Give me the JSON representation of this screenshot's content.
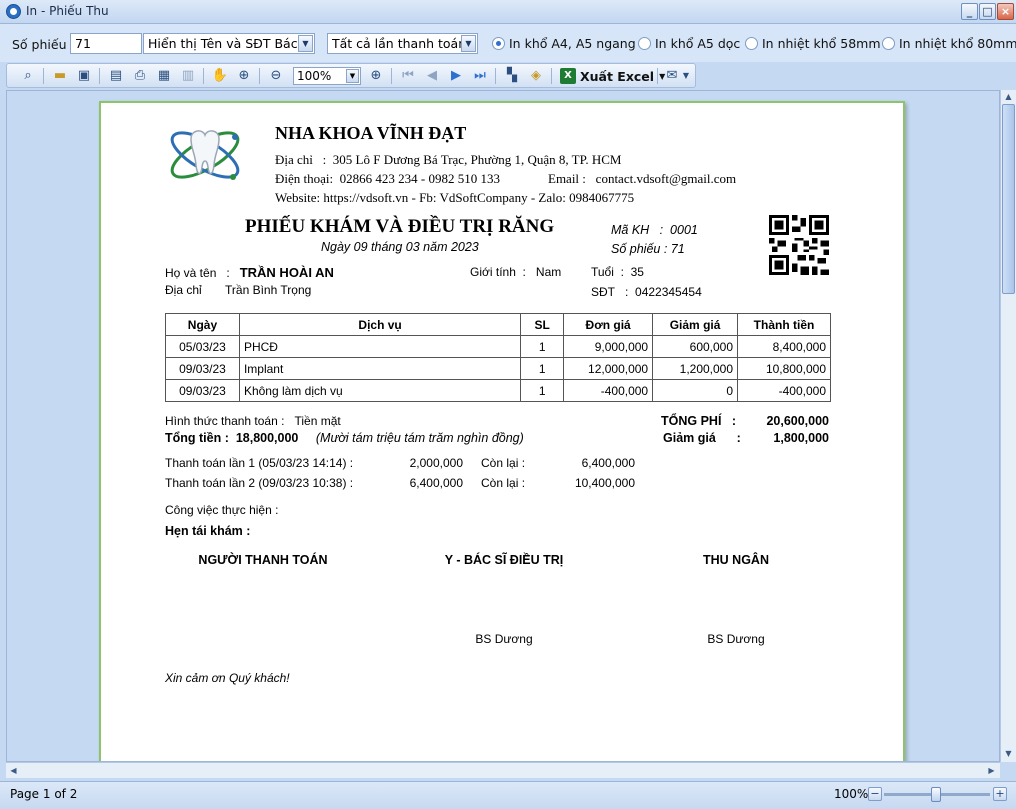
{
  "window": {
    "title": "In - Phiếu Thu"
  },
  "options": {
    "so_phieu_label": "Số phiếu",
    "so_phieu_value": "71",
    "display_select": "Hiển thị Tên và SĐT Bác sĩ",
    "payment_select": "Tất cả lần thanh toán",
    "radio_a4": "In khổ A4, A5 ngang",
    "radio_a5": "In khổ A5 dọc",
    "radio_58": "In nhiệt khổ 58mm",
    "radio_80": "In nhiệt khổ 80mm"
  },
  "toolbar": {
    "zoom": "100%",
    "excel": "Xuất Excel"
  },
  "clinic": {
    "name": "NHA KHOA VĨNH ĐẠT",
    "address_label": "Địa chỉ",
    "address": "305 Lô F Dương Bá Trạc, Phường 1, Quận 8, TP. HCM",
    "phone_label": "Điện thoại:",
    "phone": "02866 423 234 - 0982 510 133",
    "email_label": "Email :",
    "email": "contact.vdsoft@gmail.com",
    "web": "Website: https://vdsoft.vn  -  Fb: VdSoftCompany  -  Zalo: 0984067775"
  },
  "receipt": {
    "title": "PHIẾU KHÁM VÀ ĐIỀU TRỊ RĂNG",
    "date": "Ngày 09 tháng 03 năm 2023",
    "ma_kh_label": "Mã KH",
    "ma_kh": "0001",
    "so_phieu_label": "Số phiếu :",
    "so_phieu": "71"
  },
  "patient": {
    "name_label": "Họ và tên",
    "name": "TRẦN HOÀI AN",
    "gender_label": "Giới tính",
    "gender": "Nam",
    "age_label": "Tuổi",
    "age": "35",
    "addr_label": "Địa chỉ",
    "addr": "Trần Bình Trọng",
    "phone_label": "SĐT",
    "phone": "0422345454"
  },
  "table": {
    "headers": [
      "Ngày",
      "Dịch vụ",
      "SL",
      "Đơn giá",
      "Giảm giá",
      "Thành tiền"
    ],
    "rows": [
      [
        "05/03/23",
        "PHCĐ",
        "1",
        "9,000,000",
        "600,000",
        "8,400,000"
      ],
      [
        "09/03/23",
        "Implant",
        "1",
        "12,000,000",
        "1,200,000",
        "10,800,000"
      ],
      [
        "09/03/23",
        "Không làm dịch vụ",
        "1",
        "-400,000",
        "0",
        "-400,000"
      ]
    ]
  },
  "summary": {
    "method_label": "Hình thức thanh toán :",
    "method": "Tiền mặt",
    "total_label": "Tổng tiền :",
    "total": "18,800,000",
    "total_words": "(Mười tám triệu tám trăm nghìn đồng)",
    "fee_label": "TỔNG PHÍ",
    "fee": "20,600,000",
    "discount_label": "Giảm giá",
    "discount": "1,800,000"
  },
  "payments": [
    {
      "label": "Thanh toán lần 1 (05/03/23 14:14) :",
      "amount": "2,000,000",
      "remain_label": "Còn lại :",
      "remain": "6,400,000"
    },
    {
      "label": "Thanh toán lần 2 (09/03/23 10:38) :",
      "amount": "6,400,000",
      "remain_label": "Còn lại :",
      "remain": "10,400,000"
    }
  ],
  "work": {
    "label": "Công việc thực hiện :",
    "recall": "Hẹn tái khám :"
  },
  "signatures": {
    "payer": "NGƯỜI THANH TOÁN",
    "doctor": "Y - BÁC SĨ ĐIỀU TRỊ",
    "cashier": "THU NGÂN",
    "doctor_name": "BS Dương",
    "cashier_name": "BS Dương"
  },
  "thanks": "Xin cảm ơn Quý khách!",
  "status": {
    "page": "Page 1 of 2",
    "zoom": "100%"
  }
}
